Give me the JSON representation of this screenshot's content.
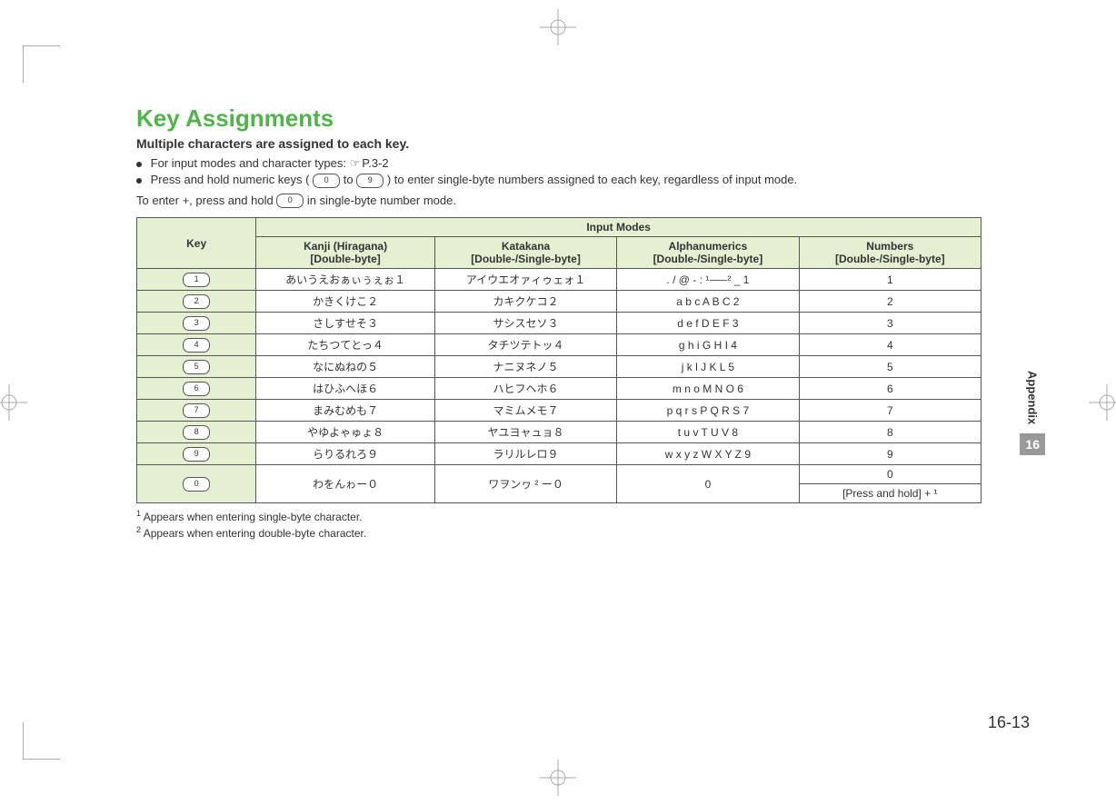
{
  "title": "Key Assignments",
  "subtitle": "Multiple characters are assigned to each key.",
  "bullet1_prefix": "For input modes and character types: ",
  "bullet1_ref": "P.3-2",
  "bullet2_a": "Press and hold numeric keys (",
  "bullet2_b": " to ",
  "bullet2_c": ") to enter single-byte numbers assigned to each key, regardless of input mode.",
  "note_a": "To enter +, press and hold ",
  "note_b": " in single-byte number mode.",
  "key0": "0",
  "key9": "9",
  "headers": {
    "key": "Key",
    "modes": "Input Modes",
    "kanji1": "Kanji (Hiragana)",
    "kanji2": "[Double-byte]",
    "kata1": "Katakana",
    "kata2": "[Double-/Single-byte]",
    "alpha1": "Alphanumerics",
    "alpha2": "[Double-/Single-byte]",
    "num1": "Numbers",
    "num2": "[Double-/Single-byte]"
  },
  "rows": [
    {
      "k": "1",
      "kanji": "あいうえおぁぃぅぇぉ１",
      "kata": "アイウエオァィゥェォ１",
      "alpha": ". / @ - : ¹⸺² _  1",
      "num": "1"
    },
    {
      "k": "2",
      "kanji": "かきくけこ２",
      "kata": "カキクケコ２",
      "alpha": "a b c A B C 2",
      "num": "2"
    },
    {
      "k": "3",
      "kanji": "さしすせそ３",
      "kata": "サシスセソ３",
      "alpha": "d e f D E F 3",
      "num": "3"
    },
    {
      "k": "4",
      "kanji": "たちつてとっ４",
      "kata": "タチツテトッ４",
      "alpha": "g h i G H I 4",
      "num": "4"
    },
    {
      "k": "5",
      "kanji": "なにぬねの５",
      "kata": "ナニヌネノ５",
      "alpha": "j k l J K L 5",
      "num": "5"
    },
    {
      "k": "6",
      "kanji": "はひふへほ６",
      "kata": "ハヒフヘホ６",
      "alpha": "m n o M N O 6",
      "num": "6"
    },
    {
      "k": "7",
      "kanji": "まみむめも７",
      "kata": "マミムメモ７",
      "alpha": "p q r s P Q R S 7",
      "num": "7"
    },
    {
      "k": "8",
      "kanji": "やゆよゃゅょ８",
      "kata": "ヤユヨャュョ８",
      "alpha": "t u v T U V 8",
      "num": "8"
    },
    {
      "k": "9",
      "kanji": "らりるれろ９",
      "kata": "ラリルレロ９",
      "alpha": "w x y z W X Y Z 9",
      "num": "9"
    }
  ],
  "row0": {
    "k": "0",
    "kanji": "わをんゎー０",
    "kata": "ワヲンヮ ² ー０",
    "alpha": "0",
    "num_a": "0",
    "num_b": "[Press and hold] + ¹"
  },
  "fn1": " Appears when entering single-byte character.",
  "fn2": " Appears when entering double-byte character.",
  "side_label": "Appendix",
  "side_num": "16",
  "page_num": "16-13"
}
